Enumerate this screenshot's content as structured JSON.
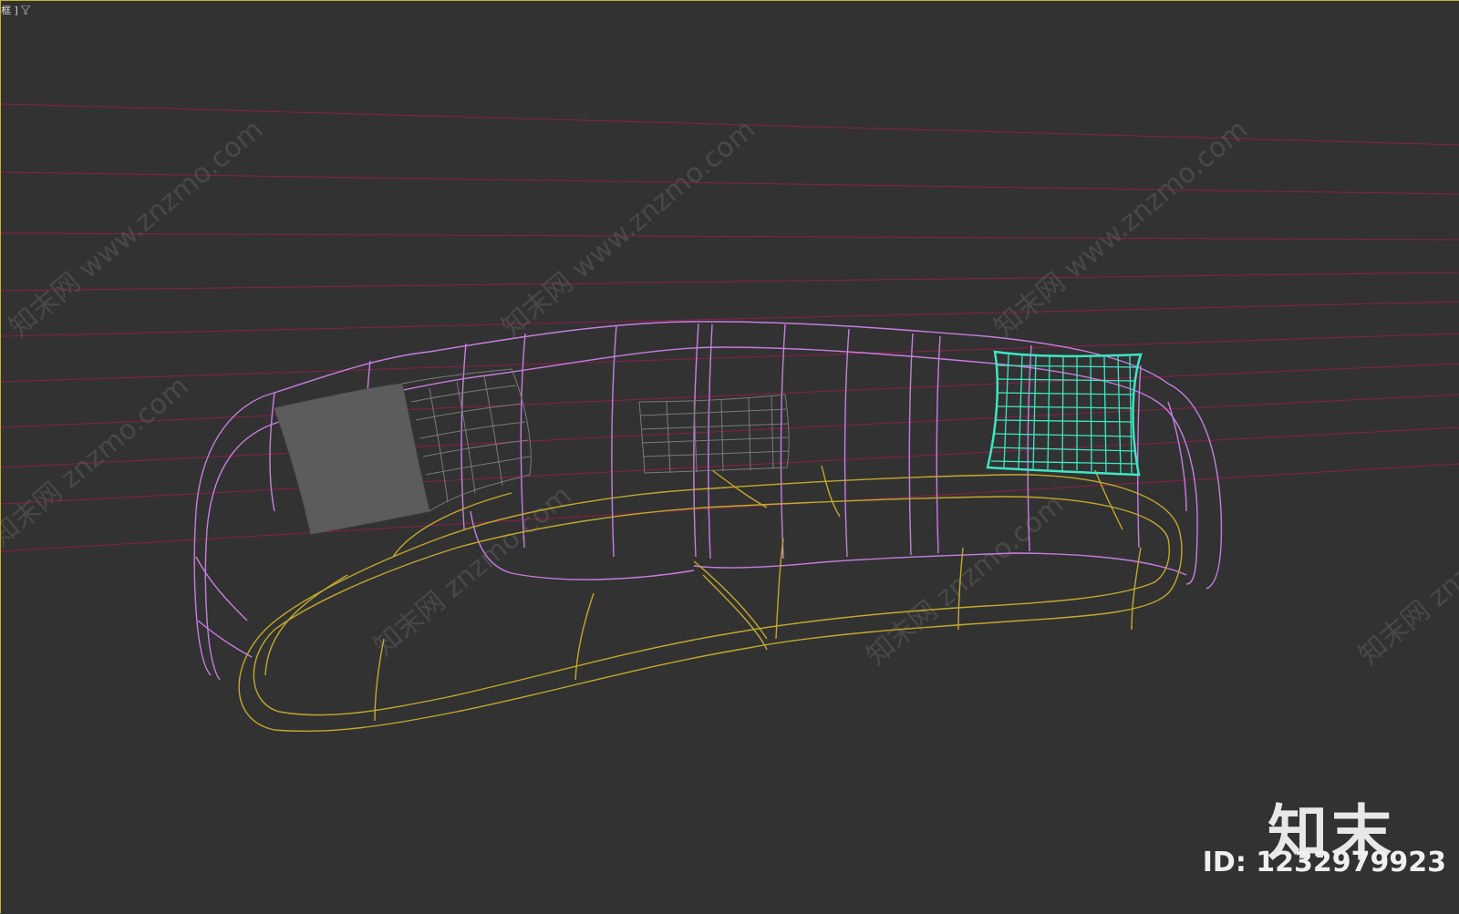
{
  "viewport": {
    "label": "框 ]",
    "filter_icon": "funnel-icon",
    "frame_color": "#c8b52a",
    "background_color": "#323232"
  },
  "scene": {
    "object": "sofa-wireframe",
    "colors": {
      "sofa_back": "#c77ee0",
      "sofa_seat": "#c2a92c",
      "pillow_selected": "#3ee6c4",
      "pillow_grey": "#7a7a7a",
      "pillow_solid": "#5c5c5c",
      "guide_lines": "#8c1e4a"
    }
  },
  "watermarks": {
    "text_a": "知末网 www.znzmo.com",
    "text_b": "知末网 znzmo.com"
  },
  "branding": {
    "logo": "知末",
    "id_text": "ID: 1232979923"
  }
}
